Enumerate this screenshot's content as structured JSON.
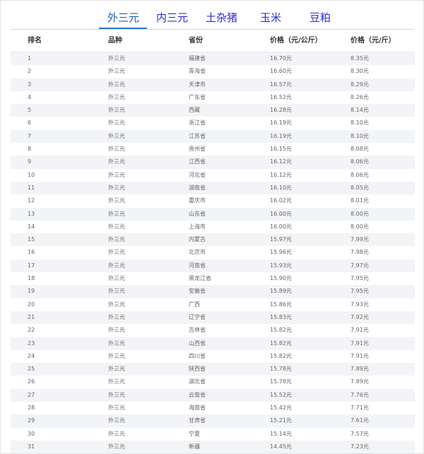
{
  "tabs": [
    {
      "label": "外三元",
      "active": true
    },
    {
      "label": "内三元",
      "active": false
    },
    {
      "label": "土杂猪",
      "active": false
    },
    {
      "label": "玉米",
      "active": false
    },
    {
      "label": "豆粕",
      "active": false
    }
  ],
  "table": {
    "headers": [
      "排名",
      "品种",
      "省份",
      "价格（元/公斤）",
      "价格（元/斤）"
    ],
    "rows": [
      [
        "1",
        "外三元",
        "福建省",
        "16.70元",
        "8.35元"
      ],
      [
        "2",
        "外三元",
        "青海省",
        "16.60元",
        "8.30元"
      ],
      [
        "3",
        "外三元",
        "天津市",
        "16.57元",
        "8.29元"
      ],
      [
        "4",
        "外三元",
        "广东省",
        "16.52元",
        "8.26元"
      ],
      [
        "5",
        "外三元",
        "西藏",
        "16.28元",
        "8.14元"
      ],
      [
        "6",
        "外三元",
        "浙江省",
        "16.19元",
        "8.10元"
      ],
      [
        "7",
        "外三元",
        "江苏省",
        "16.19元",
        "8.10元"
      ],
      [
        "8",
        "外三元",
        "贵州省",
        "16.15元",
        "8.08元"
      ],
      [
        "9",
        "外三元",
        "江西省",
        "16.12元",
        "8.06元"
      ],
      [
        "10",
        "外三元",
        "河北省",
        "16.12元",
        "8.06元"
      ],
      [
        "11",
        "外三元",
        "湖南省",
        "16.10元",
        "8.05元"
      ],
      [
        "12",
        "外三元",
        "重庆市",
        "16.02元",
        "8.01元"
      ],
      [
        "13",
        "外三元",
        "山东省",
        "16.00元",
        "8.00元"
      ],
      [
        "14",
        "外三元",
        "上海市",
        "16.00元",
        "8.00元"
      ],
      [
        "15",
        "外三元",
        "内蒙古",
        "15.97元",
        "7.99元"
      ],
      [
        "16",
        "外三元",
        "北京市",
        "15.96元",
        "7.98元"
      ],
      [
        "17",
        "外三元",
        "河南省",
        "15.93元",
        "7.97元"
      ],
      [
        "18",
        "外三元",
        "黑龙江省",
        "15.90元",
        "7.95元"
      ],
      [
        "19",
        "外三元",
        "安徽省",
        "15.89元",
        "7.95元"
      ],
      [
        "20",
        "外三元",
        "广西",
        "15.86元",
        "7.93元"
      ],
      [
        "21",
        "外三元",
        "辽宁省",
        "15.83元",
        "7.92元"
      ],
      [
        "22",
        "外三元",
        "吉林省",
        "15.82元",
        "7.91元"
      ],
      [
        "23",
        "外三元",
        "山西省",
        "15.82元",
        "7.91元"
      ],
      [
        "24",
        "外三元",
        "四川省",
        "15.82元",
        "7.91元"
      ],
      [
        "25",
        "外三元",
        "陕西省",
        "15.78元",
        "7.89元"
      ],
      [
        "26",
        "外三元",
        "湖北省",
        "15.78元",
        "7.89元"
      ],
      [
        "27",
        "外三元",
        "云南省",
        "15.52元",
        "7.76元"
      ],
      [
        "28",
        "外三元",
        "海南省",
        "15.42元",
        "7.71元"
      ],
      [
        "29",
        "外三元",
        "甘肃省",
        "15.21元",
        "7.61元"
      ],
      [
        "30",
        "外三元",
        "宁夏",
        "15.14元",
        "7.57元"
      ],
      [
        "31",
        "外三元",
        "新疆",
        "14.45元",
        "7.23元"
      ]
    ]
  }
}
